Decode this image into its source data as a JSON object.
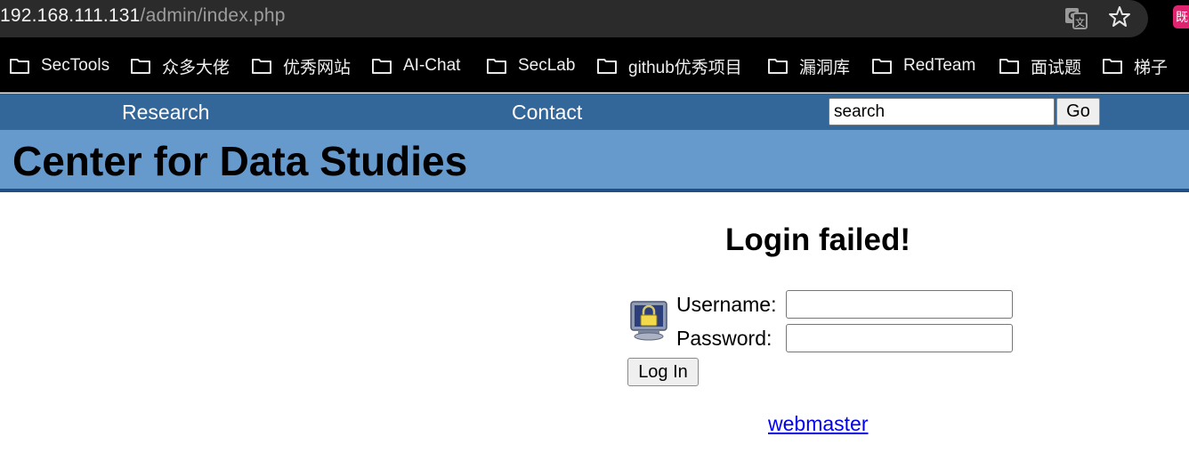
{
  "browser": {
    "url_host": "192.168.111.131",
    "url_path": "/admin/index.php",
    "ext_badge": "既"
  },
  "bookmarks": [
    {
      "label": "SecTools"
    },
    {
      "label": "众多大佬"
    },
    {
      "label": "优秀网站"
    },
    {
      "label": "AI-Chat"
    },
    {
      "label": "SecLab"
    },
    {
      "label": "github优秀项目"
    },
    {
      "label": "漏洞库"
    },
    {
      "label": "RedTeam"
    },
    {
      "label": "面试题"
    },
    {
      "label": "梯子"
    }
  ],
  "nav": {
    "research": "Research",
    "contact": "Contact",
    "search_value": "search",
    "go_label": "Go"
  },
  "header": {
    "title": "Center for Data Studies"
  },
  "login": {
    "heading": "Login failed!",
    "username_label": "Username:",
    "password_label": "Password:",
    "username_value": "",
    "password_value": "",
    "button_label": "Log In",
    "webmaster_link": "webmaster"
  },
  "colors": {
    "nav_bg": "#336699",
    "header_bg": "#6699cc",
    "header_border": "#1f4f84",
    "link": "#0000ee"
  }
}
